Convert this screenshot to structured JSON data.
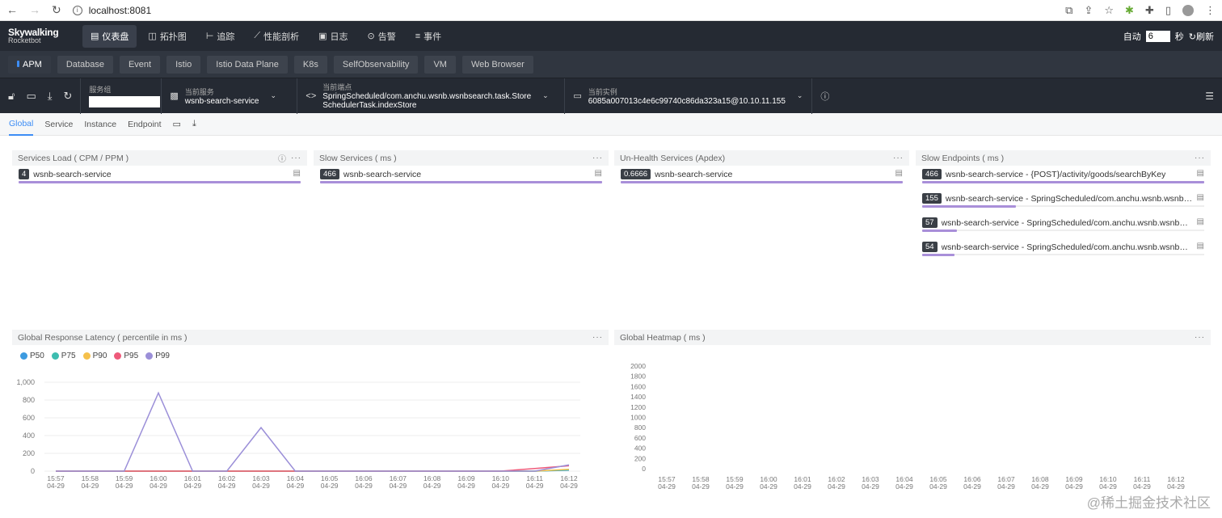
{
  "browser": {
    "url": "localhost:8081"
  },
  "app": {
    "logo_main": "Skywalking",
    "logo_sub": "Rocketbot"
  },
  "topnav": [
    {
      "icon": "dashboard-icon",
      "glyph": "▤",
      "label": "仪表盘",
      "active": true
    },
    {
      "icon": "topology-icon",
      "glyph": "◫",
      "label": "拓扑图",
      "active": false
    },
    {
      "icon": "trace-icon",
      "glyph": "⊢",
      "label": "追踪",
      "active": false
    },
    {
      "icon": "profile-icon",
      "glyph": "⟋",
      "label": "性能剖析",
      "active": false
    },
    {
      "icon": "log-icon",
      "glyph": "▣",
      "label": "日志",
      "active": false
    },
    {
      "icon": "alarm-icon",
      "glyph": "⊙",
      "label": "告警",
      "active": false
    },
    {
      "icon": "event-icon",
      "glyph": "≡",
      "label": "事件",
      "active": false
    }
  ],
  "refresh": {
    "auto_label": "自动",
    "interval": "6",
    "unit": "秒",
    "refresh_label": "刷新"
  },
  "layers": [
    "APM",
    "Database",
    "Event",
    "Istio",
    "Istio Data Plane",
    "K8s",
    "SelfObservability",
    "VM",
    "Web Browser"
  ],
  "selectors": {
    "group_label": "服务组",
    "service_label": "当前服务",
    "service_value": "wsnb-search-service",
    "endpoint_label": "当前端点",
    "endpoint_value_1": "SpringScheduled/com.anchu.wsnb.wsnbsearch.task.Store",
    "endpoint_value_2": "SchedulerTask.indexStore",
    "instance_label": "当前实例",
    "instance_value": "6085a007013c4e6c99740c86da323a15@10.10.11.155"
  },
  "subtabs": [
    "Global",
    "Service",
    "Instance",
    "Endpoint"
  ],
  "panels": {
    "services_load": {
      "title": "Services Load ( CPM / PPM )",
      "items": [
        {
          "value": "4",
          "name": "wsnb-search-service",
          "ratio": 1.0
        }
      ]
    },
    "slow_services": {
      "title": "Slow Services ( ms )",
      "items": [
        {
          "value": "466",
          "name": "wsnb-search-service",
          "ratio": 1.0
        }
      ]
    },
    "unhealth_services": {
      "title": "Un-Health Services (Apdex)",
      "items": [
        {
          "value": "0.6666",
          "name": "wsnb-search-service",
          "ratio": 1.0
        }
      ]
    },
    "slow_endpoints": {
      "title": "Slow Endpoints ( ms )",
      "items": [
        {
          "value": "466",
          "name": "wsnb-search-service - {POST}/activity/goods/searchByKey",
          "ratio": 1.0
        },
        {
          "value": "155",
          "name": "wsnb-search-service - SpringScheduled/com.anchu.wsnb.wsnbse...",
          "ratio": 0.333
        },
        {
          "value": "57",
          "name": "wsnb-search-service - SpringScheduled/com.anchu.wsnb.wsnbsea...",
          "ratio": 0.122
        },
        {
          "value": "54",
          "name": "wsnb-search-service - SpringScheduled/com.anchu.wsnb.wsnbsea...",
          "ratio": 0.116
        }
      ]
    },
    "latency": {
      "title": "Global Response Latency ( percentile in ms )"
    },
    "heatmap": {
      "title": "Global Heatmap ( ms )"
    }
  },
  "watermark": "@稀土掘金技术社区",
  "chart_data": [
    {
      "type": "line",
      "x": [
        "15:57\n04-29",
        "15:58\n04-29",
        "15:59\n04-29",
        "16:00\n04-29",
        "16:01\n04-29",
        "16:02\n04-29",
        "16:03\n04-29",
        "16:04\n04-29",
        "16:05\n04-29",
        "16:06\n04-29",
        "16:07\n04-29",
        "16:08\n04-29",
        "16:09\n04-29",
        "16:10\n04-29",
        "16:11\n04-29",
        "16:12\n04-29"
      ],
      "ylim": [
        0,
        1000
      ],
      "yticks": [
        0,
        200,
        400,
        600,
        800,
        1000
      ],
      "ytick_labels": [
        "0",
        "200",
        "400",
        "600",
        "800",
        "1,000"
      ],
      "legend_position": "top-left",
      "series": [
        {
          "name": "P50",
          "color": "#3d9be0",
          "values": [
            0,
            0,
            0,
            0,
            0,
            0,
            0,
            0,
            0,
            0,
            0,
            0,
            0,
            0,
            0,
            10
          ]
        },
        {
          "name": "P75",
          "color": "#3dbdb0",
          "values": [
            0,
            0,
            0,
            0,
            0,
            0,
            0,
            0,
            0,
            0,
            0,
            0,
            0,
            0,
            0,
            15
          ]
        },
        {
          "name": "P90",
          "color": "#f5c04b",
          "values": [
            0,
            0,
            0,
            0,
            0,
            0,
            0,
            0,
            0,
            0,
            0,
            0,
            0,
            0,
            0,
            20
          ]
        },
        {
          "name": "P95",
          "color": "#ee5a7a",
          "values": [
            0,
            0,
            0,
            0,
            0,
            0,
            0,
            0,
            0,
            0,
            0,
            0,
            0,
            0,
            30,
            60
          ]
        },
        {
          "name": "P99",
          "color": "#9b8fd8",
          "values": [
            0,
            0,
            0,
            880,
            0,
            0,
            490,
            0,
            0,
            0,
            0,
            0,
            0,
            0,
            0,
            70
          ]
        }
      ]
    },
    {
      "type": "heatmap",
      "x": [
        "15:57\n04-29",
        "15:58\n04-29",
        "15:59\n04-29",
        "16:00\n04-29",
        "16:01\n04-29",
        "16:02\n04-29",
        "16:03\n04-29",
        "16:04\n04-29",
        "16:05\n04-29",
        "16:06\n04-29",
        "16:07\n04-29",
        "16:08\n04-29",
        "16:09\n04-29",
        "16:10\n04-29",
        "16:11\n04-29",
        "16:12\n04-29"
      ],
      "y": [
        "0",
        "200",
        "400",
        "600",
        "800",
        "1000",
        "1200",
        "1400",
        "1600",
        "1800",
        "2000"
      ],
      "values": []
    }
  ]
}
